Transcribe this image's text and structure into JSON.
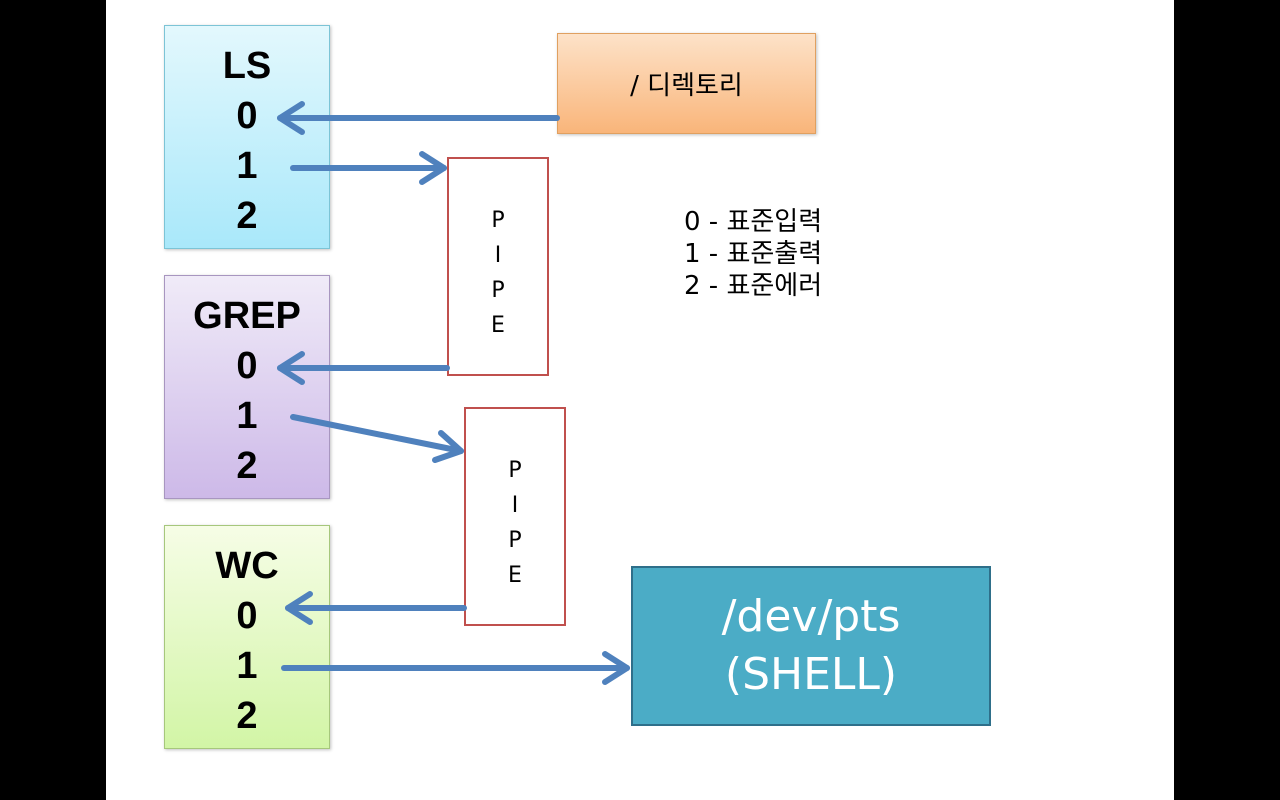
{
  "processes": {
    "ls": {
      "name": "LS",
      "fds": [
        "0",
        "1",
        "2"
      ]
    },
    "grep": {
      "name": "GREP",
      "fds": [
        "0",
        "1",
        "2"
      ]
    },
    "wc": {
      "name": "WC",
      "fds": [
        "0",
        "1",
        "2"
      ]
    }
  },
  "pipes": [
    {
      "letters": [
        "P",
        "I",
        "P",
        "E"
      ]
    },
    {
      "letters": [
        "P",
        "I",
        "P",
        "E"
      ]
    }
  ],
  "directory": {
    "label": "/ 디렉토리"
  },
  "shell": {
    "line1": "/dev/pts",
    "line2": "(SHELL)"
  },
  "legend": [
    "0 - 표준입력",
    "1 - 표준출력",
    "2 - 표준에러"
  ],
  "colors": {
    "arrow": "#4f81bd",
    "pipe_border": "#c0504d",
    "shell_fill": "#4bacc6"
  }
}
